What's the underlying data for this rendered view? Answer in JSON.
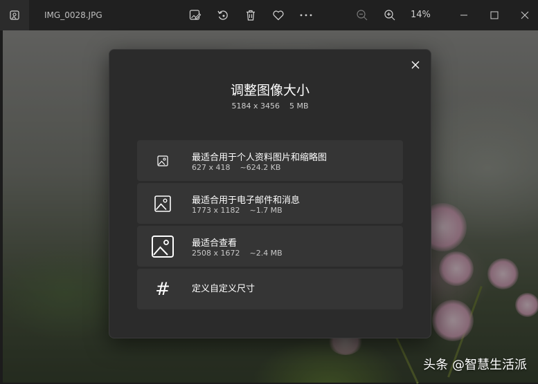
{
  "window": {
    "filename": "IMG_0028.JPG",
    "zoom": "14%"
  },
  "toolbar": {
    "icons": [
      "edit-image-icon",
      "rotate-icon",
      "delete-icon",
      "favorite-icon",
      "more-icon",
      "zoom-out-icon",
      "zoom-in-icon"
    ]
  },
  "dialog": {
    "title": "调整图像大小",
    "subtitle": "5184 x 3456    5 MB",
    "options": [
      {
        "title": "最适合用于个人资料图片和缩略图",
        "detail": "627 x 418    ~624.2 KB"
      },
      {
        "title": "最适合用于电子邮件和消息",
        "detail": "1773 x 1182    ~1.7 MB"
      },
      {
        "title": "最适合查看",
        "detail": "2508 x 1672    ~2.4 MB"
      },
      {
        "title": "定义自定义尺寸",
        "icon_glyph": "#"
      }
    ]
  },
  "watermark": "头条 @智慧生活派"
}
